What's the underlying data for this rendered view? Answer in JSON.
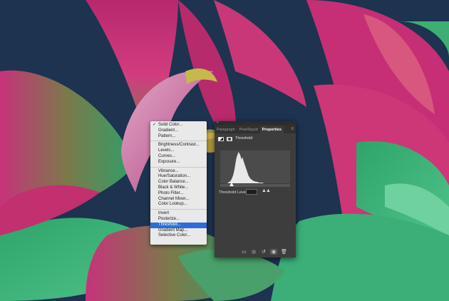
{
  "menu": {
    "items": [
      {
        "label": "Solid Color...",
        "checked": true
      },
      {
        "label": "Gradient..."
      },
      {
        "label": "Pattern..."
      },
      {
        "sep": true
      },
      {
        "label": "Brightness/Contrast..."
      },
      {
        "label": "Levels..."
      },
      {
        "label": "Curves..."
      },
      {
        "label": "Exposure..."
      },
      {
        "sep": true
      },
      {
        "label": "Vibrance..."
      },
      {
        "label": "Hue/Saturation..."
      },
      {
        "label": "Color Balance..."
      },
      {
        "label": "Black & White..."
      },
      {
        "label": "Photo Filter..."
      },
      {
        "label": "Channel Mixer..."
      },
      {
        "label": "Color Lookup..."
      },
      {
        "sep": true
      },
      {
        "label": "Invert"
      },
      {
        "label": "Posterize..."
      },
      {
        "label": "Threshold...",
        "highlighted": true
      },
      {
        "label": "Gradient Map..."
      },
      {
        "label": "Selective Color..."
      }
    ]
  },
  "panel": {
    "tabs": [
      "Paragraph",
      "PixelSquid",
      "Properties"
    ],
    "active_tab": "Properties",
    "title": "Threshold",
    "threshold_label": "Threshold Level:",
    "threshold_value": "",
    "footer_icons": [
      "clip-to-layer-icon",
      "view-previous-state-icon",
      "reset-icon",
      "visibility-eye-icon",
      "trash-icon"
    ]
  },
  "histogram": [
    0,
    0,
    0,
    0,
    0,
    0,
    0,
    0,
    1,
    2,
    3,
    5,
    8,
    12,
    18,
    26,
    34,
    38,
    42,
    40,
    37,
    32,
    35,
    30,
    26,
    22,
    18,
    14,
    10,
    8,
    6,
    5,
    4,
    3,
    3,
    2,
    2,
    2,
    1,
    1,
    1,
    1,
    1,
    0,
    0,
    0,
    0,
    0,
    0,
    0,
    0,
    0,
    0,
    0,
    0,
    0,
    0,
    0,
    0,
    0,
    0,
    0,
    0,
    0,
    0,
    0,
    0,
    0,
    0,
    0
  ],
  "colors": {
    "accent": "#2b6fd6",
    "panel_bg": "#3d3d3d",
    "backdrop": "#1d3350"
  }
}
